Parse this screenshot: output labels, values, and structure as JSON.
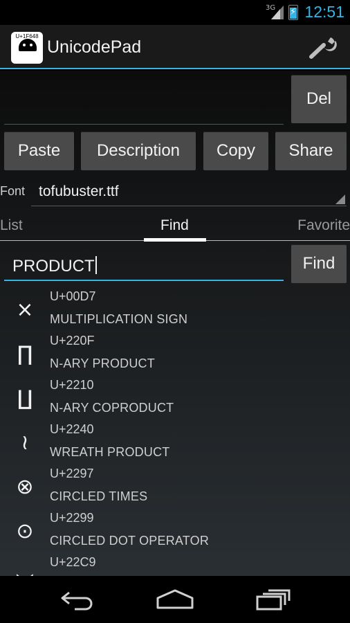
{
  "status": {
    "network": "3G",
    "time": "12:51",
    "accent": "#33b5e5"
  },
  "app": {
    "title": "UnicodePad",
    "logo_code": "U+1F648",
    "settings_icon": "wrench-icon"
  },
  "editor": {
    "text": "",
    "del_label": "Del"
  },
  "actions": {
    "paste": "Paste",
    "description": "Description",
    "copy": "Copy",
    "share": "Share"
  },
  "font": {
    "label": "Font",
    "value": "tofubuster.ttf"
  },
  "tabs": {
    "list": "List",
    "find": "Find",
    "favorite": "Favorite",
    "active": "Find"
  },
  "search": {
    "value": "PRODUCT",
    "button": "Find"
  },
  "results": [
    {
      "glyph": "×",
      "code": "U+00D7",
      "name": "MULTIPLICATION SIGN"
    },
    {
      "glyph": "∏",
      "code": "U+220F",
      "name": "N-ARY PRODUCT"
    },
    {
      "glyph": "∐",
      "code": "U+2210",
      "name": "N-ARY COPRODUCT"
    },
    {
      "glyph": "≀",
      "code": "U+2240",
      "name": "WREATH PRODUCT"
    },
    {
      "glyph": "⊗",
      "code": "U+2297",
      "name": "CIRCLED TIMES"
    },
    {
      "glyph": "⊙",
      "code": "U+2299",
      "name": "CIRCLED DOT OPERATOR"
    },
    {
      "glyph": "⋉",
      "code": "U+22C9",
      "name": ""
    }
  ],
  "nav": {
    "back": "back-icon",
    "home": "home-icon",
    "recents": "recents-icon"
  }
}
